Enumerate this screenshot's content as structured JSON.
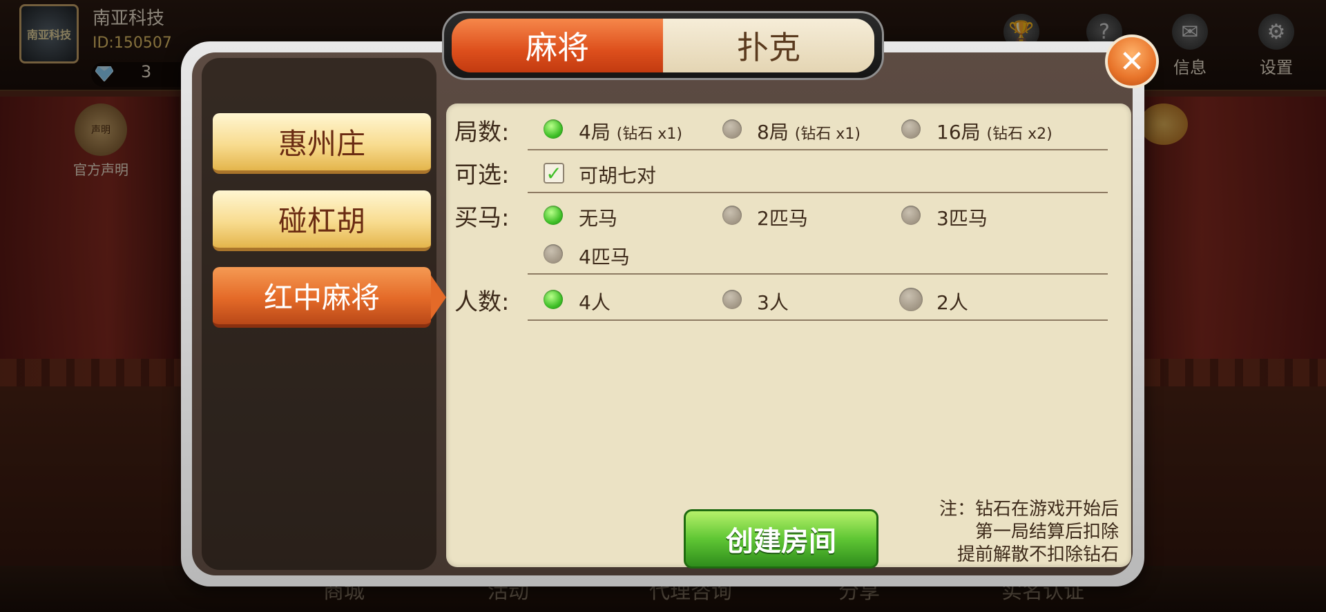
{
  "user": {
    "name": "南亚科技",
    "id": "ID:150507",
    "diamonds": "3",
    "avatar_text": "南亚科技"
  },
  "header_icons": [
    {
      "label": "战绩",
      "icon": "trophy-icon"
    },
    {
      "label": "帮",
      "icon": "help-icon"
    },
    {
      "label": "信息",
      "icon": "mail-icon"
    },
    {
      "label": "设置",
      "icon": "gear-icon"
    }
  ],
  "notice": {
    "label": "官方声明",
    "badge": "声明"
  },
  "bottom_nav": [
    "商城",
    "活动",
    "代理咨询",
    "分享",
    "实名认证"
  ],
  "dialog": {
    "tabs": {
      "active": "麻将",
      "inactive": "扑克"
    },
    "game_modes": [
      "惠州庄",
      "碰杠胡",
      "红中麻将"
    ],
    "selected_mode": "红中麻将",
    "rounds": {
      "label": "局数:",
      "options": [
        {
          "text": "4局",
          "cost": "(钻石 x1)",
          "selected": true
        },
        {
          "text": "8局",
          "cost": "(钻石 x1)",
          "selected": false
        },
        {
          "text": "16局",
          "cost": "(钻石 x2)",
          "selected": false
        }
      ]
    },
    "optional": {
      "label": "可选:",
      "checkbox": "可胡七对",
      "checked": true
    },
    "buy_horse": {
      "label": "买马:",
      "options": [
        {
          "text": "无马",
          "selected": true
        },
        {
          "text": "2匹马",
          "selected": false
        },
        {
          "text": "3匹马",
          "selected": false
        },
        {
          "text": "4匹马",
          "selected": false
        }
      ]
    },
    "players": {
      "label": "人数:",
      "options": [
        {
          "text": "4人",
          "selected": true
        },
        {
          "text": "3人",
          "selected": false
        },
        {
          "text": "2人",
          "selected": false
        }
      ]
    },
    "create_button": "创建房间",
    "note_lines": [
      "注：钻石在游戏开始后",
      "第一局结算后扣除",
      "提前解散不扣除钻石"
    ]
  },
  "colors": {
    "accent_orange": "#e46a28",
    "selected_radio": "#3fbf27",
    "panel_bg": "#ebe2c4",
    "create_green": "#5fc634"
  }
}
